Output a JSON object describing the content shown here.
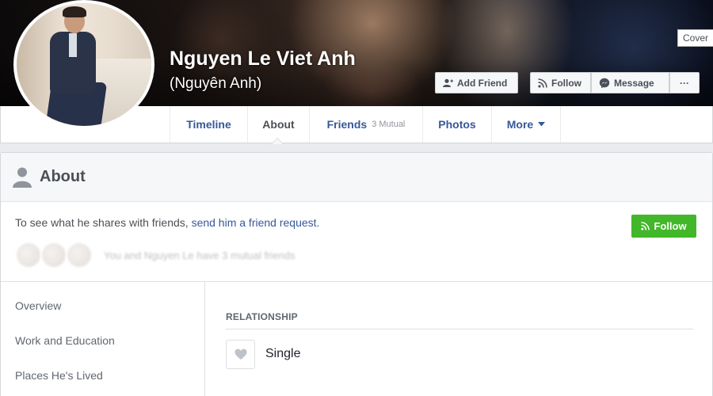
{
  "profile": {
    "name": "Nguyen Le Viet Anh",
    "alternate_name": "(Nguyên Anh)",
    "cover_tag": "Cover"
  },
  "actions": {
    "add_friend": "Add Friend",
    "follow": "Follow",
    "message": "Message",
    "more_dots": "···"
  },
  "tabs": [
    {
      "label": "Timeline"
    },
    {
      "label": "About",
      "active": true
    },
    {
      "label": "Friends",
      "sub": "3 Mutual"
    },
    {
      "label": "Photos"
    },
    {
      "label": "More"
    }
  ],
  "about": {
    "title": "About",
    "friend_request_prefix": "To see what he shares with friends, ",
    "friend_request_link": "send him a friend request.",
    "follow_button": "Follow",
    "mutual_text": "You and Nguyen Le have 3 mutual friends"
  },
  "sidebar": {
    "items": [
      "Overview",
      "Work and Education",
      "Places He's Lived"
    ]
  },
  "relationship": {
    "section_label": "RELATIONSHIP",
    "status": "Single"
  },
  "colors": {
    "link": "#365899",
    "follow_green": "#42b72a",
    "page_bg": "#e9ebee"
  }
}
